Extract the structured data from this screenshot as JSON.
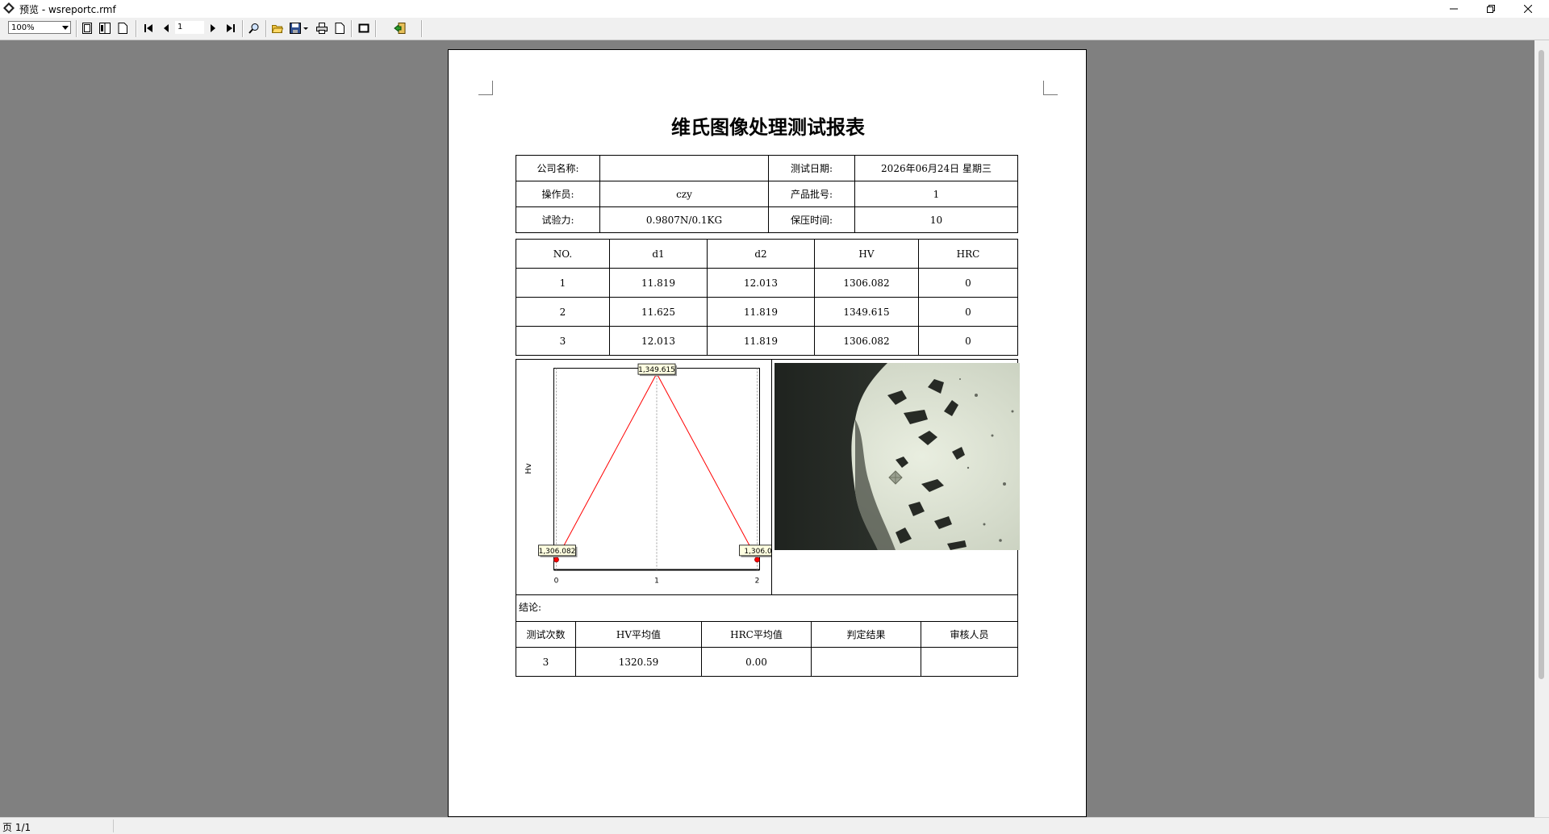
{
  "window": {
    "title": "预览 - wsreportc.rmf",
    "minimize_icon": "minimize-icon",
    "maximize_icon": "restore-icon",
    "close_icon": "close-icon"
  },
  "toolbar": {
    "zoom_value": "100%",
    "page_value": "1",
    "buttons": [
      "one-page-icon",
      "two-page-icon",
      "page-width-icon",
      "first-page-icon",
      "prev-page-icon",
      "next-page-icon",
      "last-page-icon",
      "find-icon",
      "open-icon",
      "save-icon",
      "print-icon",
      "page-setup-icon",
      "stop-icon",
      "exit-icon"
    ]
  },
  "report": {
    "title": "维氏图像处理测试报表",
    "info": {
      "company_label": "公司名称:",
      "company_value": "",
      "date_label": "测试日期:",
      "date_value": "2026年06月24日 星期三",
      "operator_label": "操作员:",
      "operator_value": "czy",
      "batch_label": "产品批号:",
      "batch_value": "1",
      "force_label": "试验力:",
      "force_value": "0.9807N/0.1KG",
      "hold_label": "保压时间:",
      "hold_value": "10"
    },
    "measurements": {
      "headers": [
        "NO.",
        "d1",
        "d2",
        "HV",
        "HRC"
      ],
      "rows": [
        [
          "1",
          "11.819",
          "12.013",
          "1306.082",
          "0"
        ],
        [
          "2",
          "11.625",
          "11.819",
          "1349.615",
          "0"
        ],
        [
          "3",
          "12.013",
          "11.819",
          "1306.082",
          "0"
        ]
      ]
    },
    "conclusion_label": "结论:",
    "summary": {
      "headers": [
        "测试次数",
        "HV平均值",
        "HRC平均值",
        "判定结果",
        "审核人员"
      ],
      "values": [
        "3",
        "1320.59",
        "0.00",
        "",
        ""
      ]
    }
  },
  "chart_data": {
    "type": "line",
    "x": [
      0,
      1,
      2
    ],
    "values": [
      1306.082,
      1349.615,
      1306.082
    ],
    "point_labels": [
      "1,306.082",
      "1,349.615",
      "1,306.0"
    ],
    "x_tick_labels": [
      "0",
      "1",
      "2"
    ],
    "ylabel": "Hv",
    "xlabel": "",
    "series_color": "#ff0000"
  },
  "statusbar": {
    "page_info": "页 1/1"
  }
}
